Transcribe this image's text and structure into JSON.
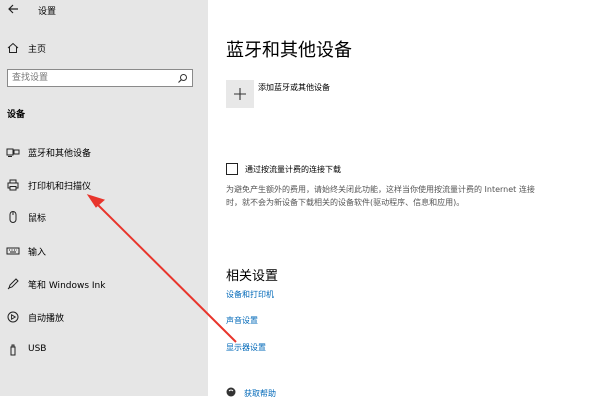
{
  "window": {
    "title": "设置"
  },
  "sidebar": {
    "home_label": "主页",
    "search_placeholder": "查找设置",
    "section_heading": "设备",
    "items": [
      {
        "label": "蓝牙和其他设备",
        "icon": "bluetooth-devices-icon"
      },
      {
        "label": "打印机和扫描仪",
        "icon": "printer-icon"
      },
      {
        "label": "鼠标",
        "icon": "mouse-icon"
      },
      {
        "label": "输入",
        "icon": "keyboard-icon"
      },
      {
        "label": "笔和 Windows Ink",
        "icon": "pen-icon"
      },
      {
        "label": "自动播放",
        "icon": "autoplay-icon"
      },
      {
        "label": "USB",
        "icon": "usb-icon"
      }
    ]
  },
  "main": {
    "title": "蓝牙和其他设备",
    "add_device_label": "添加蓝牙或其他设备",
    "metered": {
      "label": "通过按流量计费的连接下载",
      "checked": false,
      "description": "为避免产生额外的费用，请始终关闭此功能，这样当你使用按流量计费的 Internet 连接时，就不会为新设备下载相关的设备软件(驱动程序、信息和应用)。"
    },
    "related_heading": "相关设置",
    "related_links": [
      "设备和打印机",
      "声音设置",
      "显示器设置"
    ],
    "help_label": "获取帮助"
  },
  "colors": {
    "sidebar_bg": "#e6e6e6",
    "link": "#0068b8",
    "annotation_arrow": "#e8352c"
  }
}
